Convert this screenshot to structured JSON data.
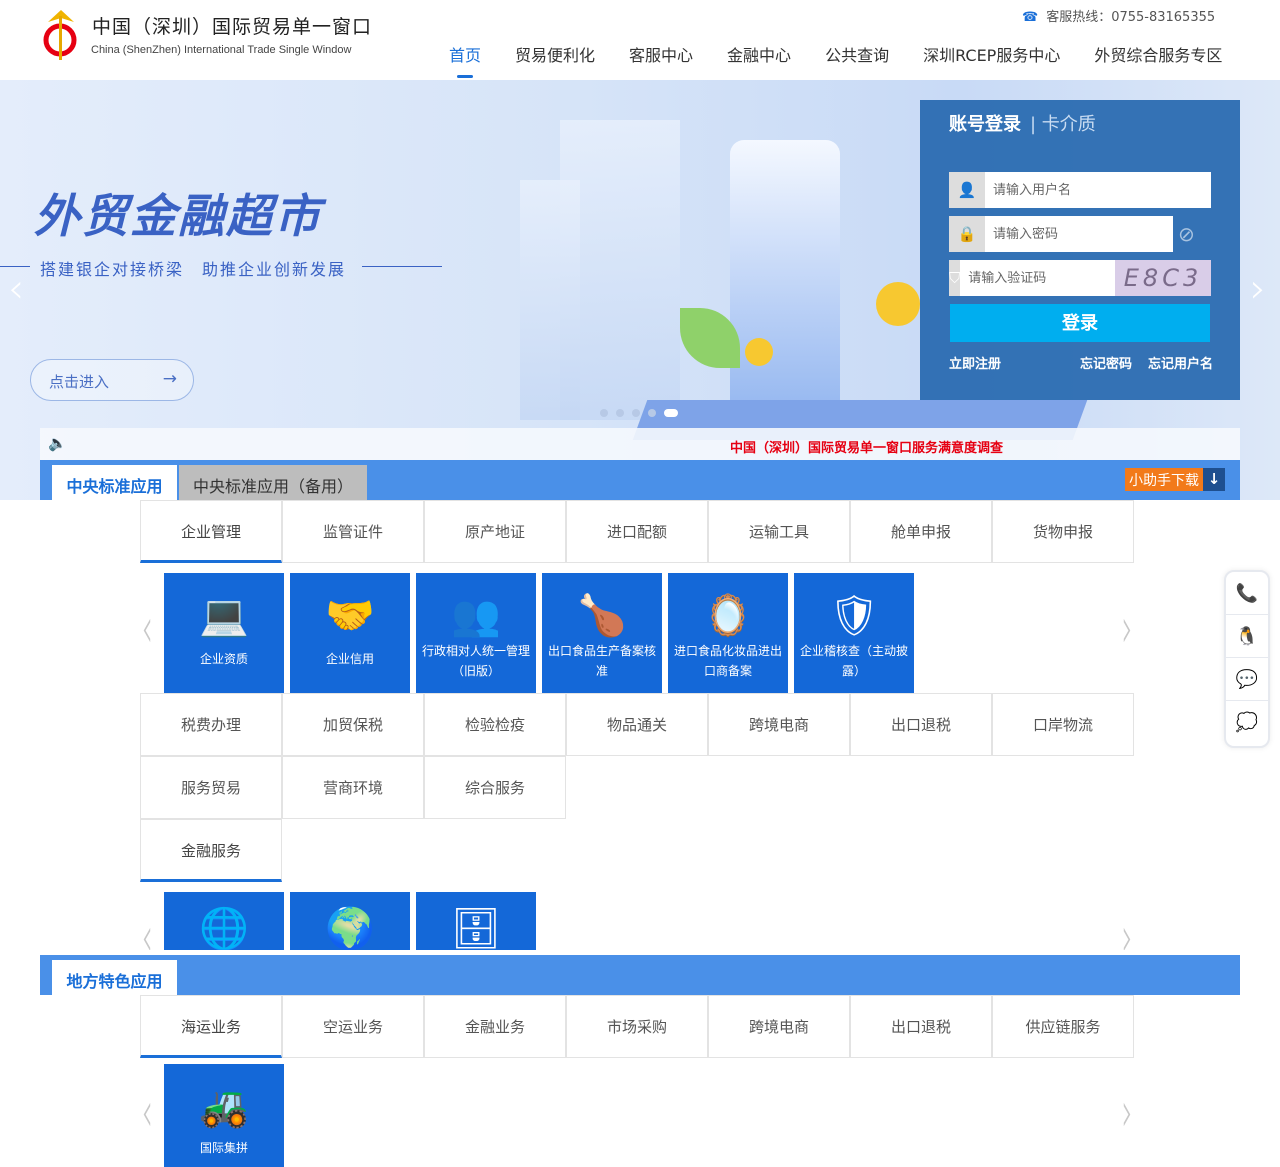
{
  "header": {
    "title": "中国（深圳）国际贸易单一窗口",
    "subtitle": "China (ShenZhen)  International Trade Single Window",
    "hotline": "客服热线：0755-83165355",
    "nav": [
      "首页",
      "贸易便利化",
      "客服中心",
      "金融中心",
      "公共查询",
      "深圳RCEP服务中心",
      "外贸综合服务专区"
    ]
  },
  "banner": {
    "title": "外贸金融超市",
    "subtitle": "搭建银企对接桥梁　助推企业创新发展",
    "enter": "点击进入",
    "arrow": "→",
    "slide_count": 5,
    "active_slide": 5
  },
  "login": {
    "tab_account": "账号登录",
    "tab_card": "| 卡介质",
    "username_placeholder": "请输入用户名",
    "password_placeholder": "请输入密码",
    "captcha_placeholder": "请输入验证码",
    "captcha_text": "E8C3",
    "submit": "登录",
    "register": "立即注册",
    "forgot_password": "忘记密码",
    "forgot_username": "忘记用户名"
  },
  "notice": {
    "text": "中国（深圳）国际贸易单一窗口服务满意度调查"
  },
  "central": {
    "tab_active": "中央标准应用",
    "tab_backup": "中央标准应用（备用）",
    "download": "小助手下载",
    "categories_row1": [
      "企业管理",
      "监管证件",
      "原产地证",
      "进口配额",
      "运输工具",
      "舱单申报",
      "货物申报"
    ],
    "tiles": [
      {
        "label": "企业资质",
        "icon": "laptop-icon",
        "glyph": "💻"
      },
      {
        "label": "企业信用",
        "icon": "handshake-icon",
        "glyph": "🤝"
      },
      {
        "label": "行政相对人统一管理（旧版）",
        "icon": "people-network-icon",
        "glyph": "👥"
      },
      {
        "label": "出口食品生产备案核准",
        "icon": "food-icon",
        "glyph": "🍗"
      },
      {
        "label": "进口食品化妆品进出口商备案",
        "icon": "cosmetics-icon",
        "glyph": "🪞"
      },
      {
        "label": "企业稽核查（主动披露）",
        "icon": "audit-shield-icon",
        "glyph": "🛡"
      }
    ],
    "categories_row2": [
      "税费办理",
      "加贸保税",
      "检验检疫",
      "物品通关",
      "跨境电商",
      "出口退税",
      "口岸物流"
    ],
    "categories_row3": [
      "服务贸易",
      "营商环境",
      "综合服务"
    ],
    "categories_row4": [
      "金融服务"
    ],
    "tiles2": [
      {
        "icon": "globe-yuan-icon",
        "glyph": "🌐"
      },
      {
        "icon": "globe-insurance-icon",
        "glyph": "🌍"
      },
      {
        "icon": "safe-icon",
        "glyph": "🗄"
      }
    ]
  },
  "local": {
    "tab": "地方特色应用",
    "categories": [
      "海运业务",
      "空运业务",
      "金融业务",
      "市场采购",
      "跨境电商",
      "出口退税",
      "供应链服务"
    ],
    "tiles": [
      {
        "label": "国际集拼",
        "icon": "forklift-icon",
        "glyph": "🚜"
      }
    ]
  },
  "side": [
    {
      "icon": "phone-icon",
      "glyph": "📞"
    },
    {
      "icon": "qq-icon",
      "glyph": "🐧"
    },
    {
      "icon": "wechat-icon",
      "glyph": "💬"
    },
    {
      "icon": "message-icon",
      "glyph": "💭"
    }
  ]
}
